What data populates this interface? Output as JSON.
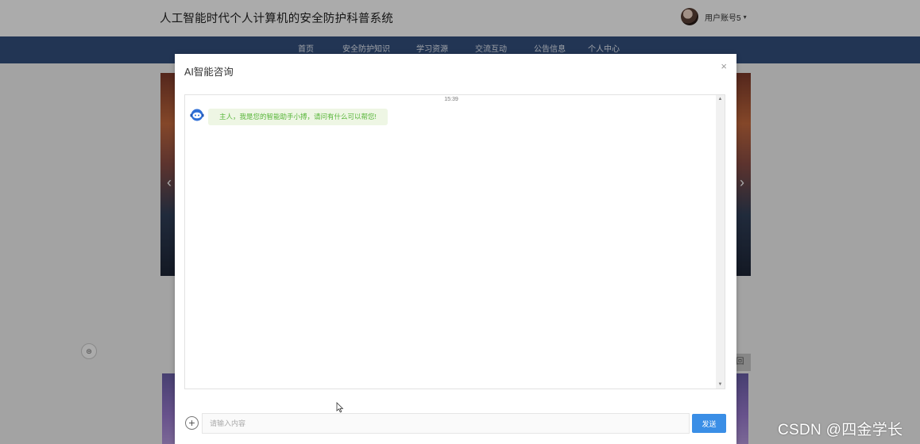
{
  "site": {
    "title": "人工智能时代个人计算机的安全防护科普系统",
    "user": {
      "name": "用户账号5",
      "caret": "▾"
    },
    "nav": [
      "首页",
      "安全防护知识",
      "学习资源",
      "交流互动",
      "公告信息",
      "个人中心"
    ],
    "banner": {
      "prev": "‹",
      "next": "›"
    },
    "more_tab": "回",
    "side_icon": "⊜"
  },
  "dialog": {
    "title": "AI智能咨询",
    "close": "×",
    "chat": {
      "time": "15:39",
      "messages": [
        {
          "from": "bot",
          "text": "主人，我是您的智能助手小搏，请问有什么可以帮您!"
        }
      ]
    },
    "composer": {
      "plus": "+",
      "placeholder": "请输入内容",
      "value": "",
      "send_label": "发送"
    }
  },
  "watermark": "CSDN @四金学长",
  "colors": {
    "nav_bg": "#33507e",
    "accent": "#3a8ee6",
    "bubble_bg": "#eef6e4",
    "bubble_text": "#58b63a"
  }
}
